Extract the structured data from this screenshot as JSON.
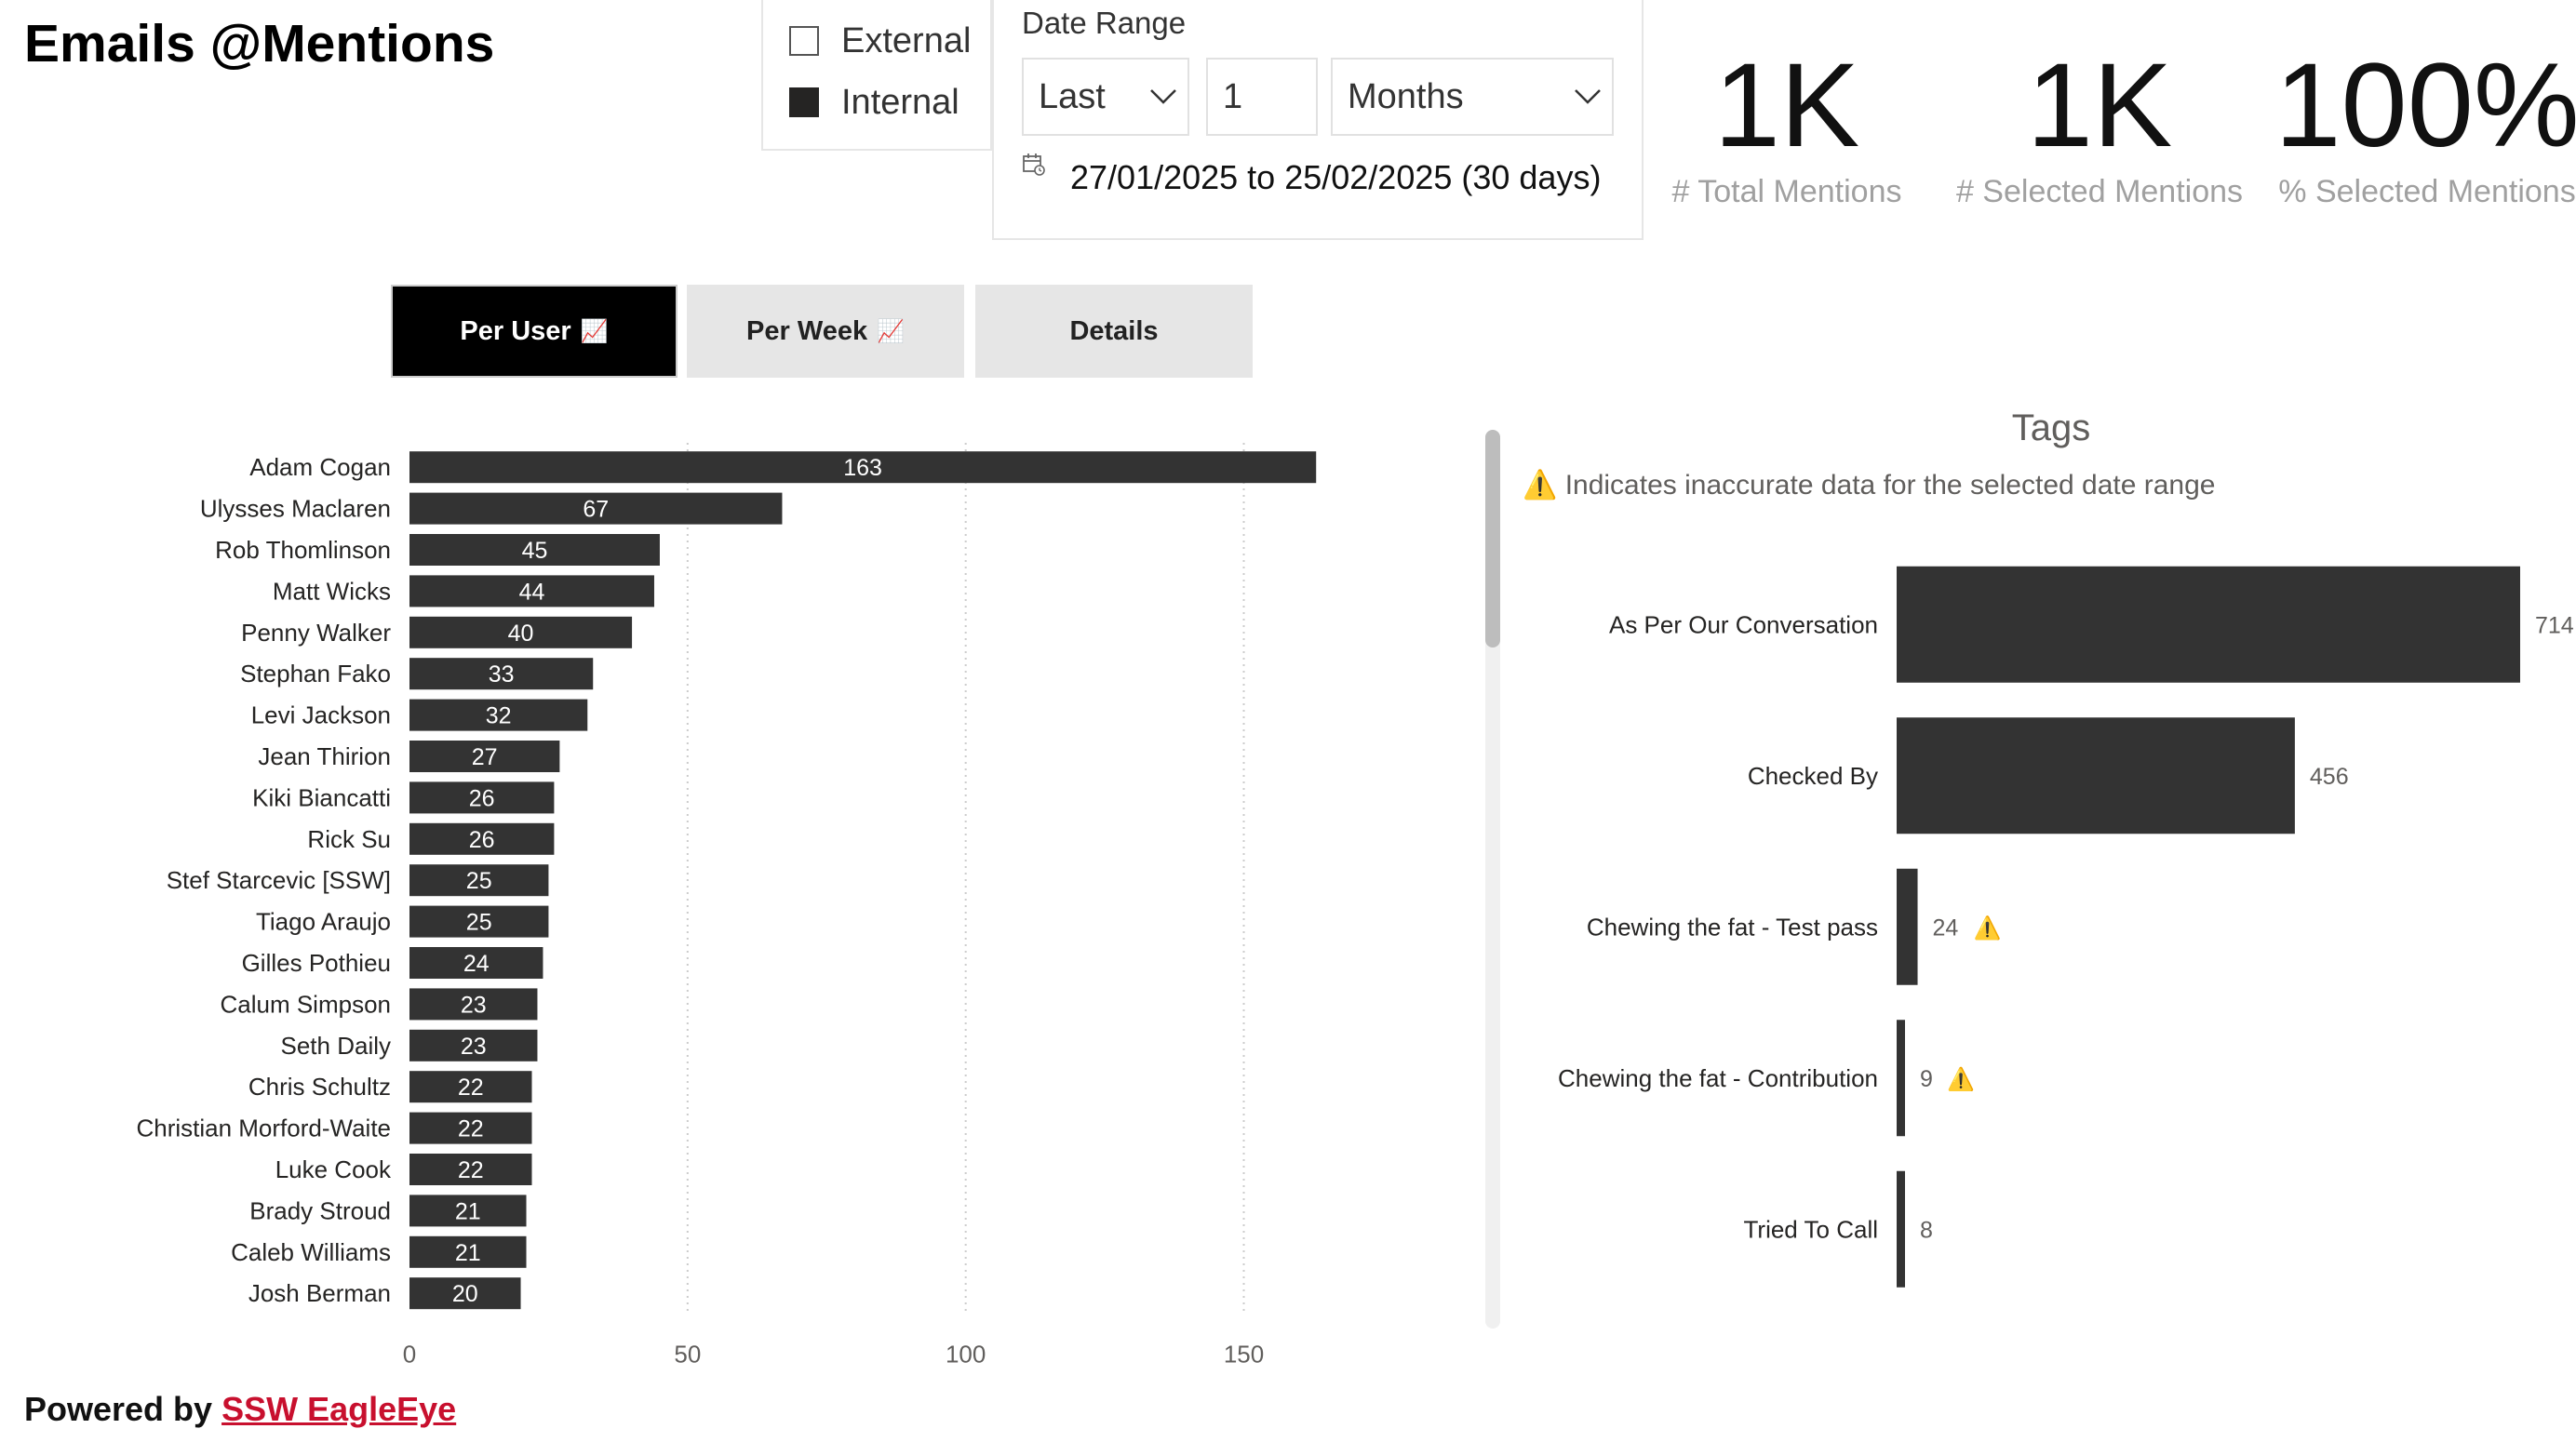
{
  "title": "Emails @Mentions",
  "audience": {
    "options": [
      {
        "label": "External",
        "checked": false
      },
      {
        "label": "Internal",
        "checked": true
      }
    ]
  },
  "date_range": {
    "title": "Date Range",
    "relative": "Last",
    "count": "1",
    "unit": "Months",
    "range_text": "27/01/2025 to 25/02/2025 (30 days)",
    "icon": "calendar-icon"
  },
  "kpis": [
    {
      "value": "1K",
      "label": "# Total Mentions"
    },
    {
      "value": "1K",
      "label": "# Selected Mentions"
    },
    {
      "value": "100%",
      "label": "% Selected Mentions"
    }
  ],
  "tabs": [
    {
      "label": "Per User",
      "emoji": "📈",
      "active": true
    },
    {
      "label": "Per Week",
      "emoji": "📈",
      "active": false
    },
    {
      "label": "Details",
      "emoji": "",
      "active": false
    }
  ],
  "footer": {
    "prefix": "Powered by ",
    "link": "SSW EagleEye"
  },
  "colors": {
    "bar": "#333333",
    "grid": "#cccccc",
    "link": "#c8102e",
    "active_tab": "#000000",
    "warning": "#f2c811"
  },
  "chart_data": [
    {
      "type": "bar",
      "orientation": "horizontal",
      "title": "",
      "categories": [
        "Adam Cogan",
        "Ulysses Maclaren",
        "Rob Thomlinson",
        "Matt Wicks",
        "Penny Walker",
        "Stephan Fako",
        "Levi Jackson",
        "Jean Thirion",
        "Kiki Biancatti",
        "Rick Su",
        "Stef Starcevic [SSW]",
        "Tiago Araujo",
        "Gilles Pothieu",
        "Calum Simpson",
        "Seth Daily",
        "Chris Schultz",
        "Christian Morford-Waite",
        "Luke Cook",
        "Brady Stroud",
        "Caleb Williams",
        "Josh Berman"
      ],
      "values": [
        163,
        67,
        45,
        44,
        40,
        33,
        32,
        27,
        26,
        26,
        25,
        25,
        24,
        23,
        23,
        22,
        22,
        22,
        21,
        21,
        20
      ],
      "xlim": [
        0,
        172
      ],
      "xticks": [
        0,
        50,
        100,
        150
      ],
      "grid": true,
      "data_labels": "inside"
    },
    {
      "type": "bar",
      "orientation": "horizontal",
      "title": "Tags",
      "subtitle": "⚠️ Indicates inaccurate data for the selected date range",
      "categories": [
        "As Per Our Conversation",
        "Checked By",
        "Chewing the fat - Test pass",
        "Chewing the fat - Contribution",
        "Tried To Call"
      ],
      "values": [
        714,
        456,
        24,
        9,
        8
      ],
      "warnings": [
        false,
        false,
        true,
        true,
        false
      ],
      "xlim": [
        0,
        714
      ],
      "data_labels": "outside"
    }
  ]
}
